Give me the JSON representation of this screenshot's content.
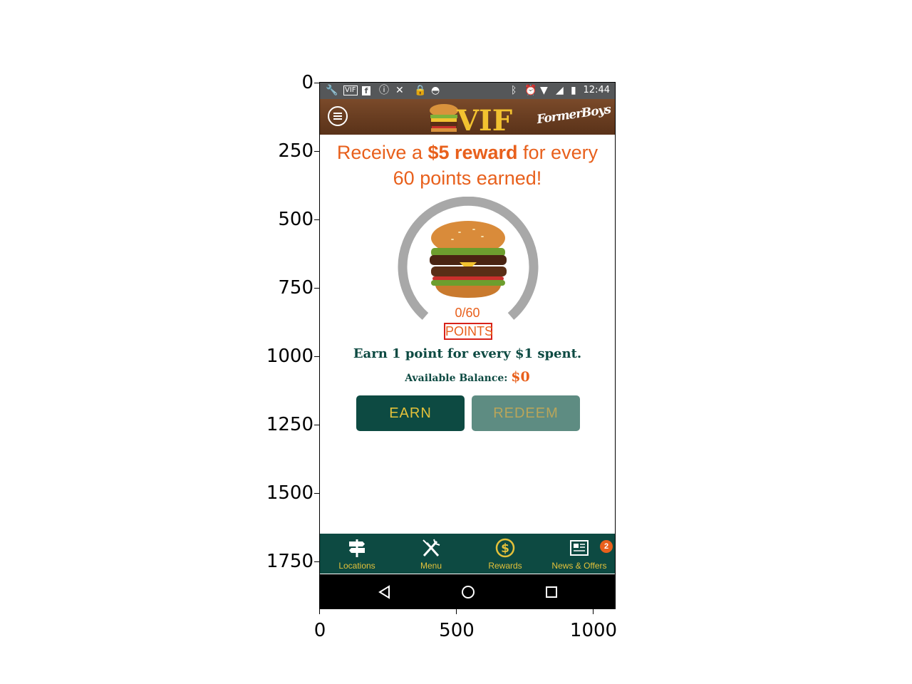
{
  "axes": {
    "y_ticks": [
      "0",
      "250",
      "500",
      "750",
      "1000",
      "1250",
      "1500",
      "1750"
    ],
    "x_ticks": [
      "0",
      "500",
      "1000"
    ]
  },
  "status_bar": {
    "time": "12:44",
    "left_icons": [
      "wrench-icon",
      "vif-icon",
      "facebook-icon",
      "info-icon",
      "tools-icon",
      "lock-icon",
      "android-icon"
    ],
    "right_icons": [
      "bluetooth-icon",
      "alarm-icon",
      "wifi-icon",
      "signal-icon",
      "battery-icon"
    ]
  },
  "header": {
    "logo_text": "VIF",
    "brand": "FormerBoys",
    "background": "#6b3f22"
  },
  "promo": {
    "line1_prefix": "Receive a ",
    "line1_bold": "$5 reward",
    "line1_suffix": " for every",
    "line2": "60 points earned!"
  },
  "rewards": {
    "points_count": "0/60",
    "points_progress": 0,
    "points_label": "POINTS",
    "earn_rate": "Earn 1 point for every $1 spent.",
    "balance_label": "Available Balance:",
    "balance_value": "$0"
  },
  "buttons": {
    "earn": "EARN",
    "redeem": "REDEEM"
  },
  "bottom_nav": {
    "items": [
      {
        "label": "Locations",
        "icon": "signpost-icon"
      },
      {
        "label": "Menu",
        "icon": "utensils-icon"
      },
      {
        "label": "Rewards",
        "icon": "dollar-coin-icon"
      },
      {
        "label": "News & Offers",
        "icon": "newspaper-icon"
      }
    ],
    "badge": "2"
  },
  "colors": {
    "accent_orange": "#e8601c",
    "primary_green": "#0d4a42",
    "gold": "#e3c13a"
  }
}
